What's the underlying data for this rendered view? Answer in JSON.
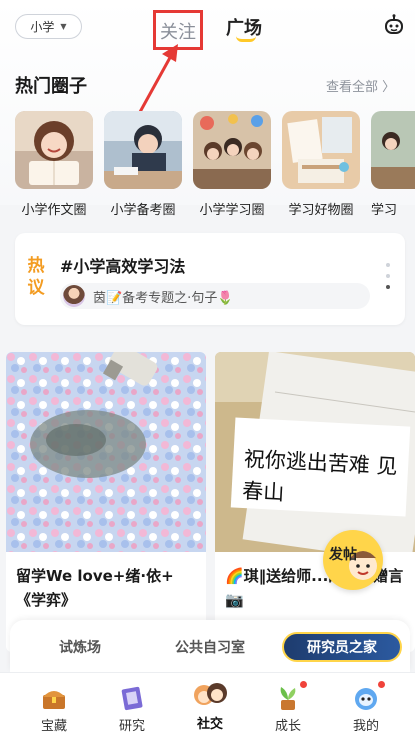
{
  "header": {
    "grade_label": "小学",
    "tabs": [
      {
        "label": "关注",
        "active": false
      },
      {
        "label": "广场",
        "active": true
      }
    ]
  },
  "hot_circles": {
    "title": "热门圈子",
    "see_all": "查看全部 〉",
    "items": [
      {
        "label": "小学作文圈",
        "icon": "girl-reading-icon"
      },
      {
        "label": "小学备考圈",
        "icon": "boy-studying-icon"
      },
      {
        "label": "小学学习圈",
        "icon": "students-group-icon"
      },
      {
        "label": "学习好物圈",
        "icon": "stationery-icon"
      },
      {
        "label": "学习",
        "icon": "classroom-icon"
      }
    ]
  },
  "hot_topic": {
    "badge": "热议",
    "title": "#小学高效学习法",
    "user_line": "茵📝备考专题之·句子🌷"
  },
  "feed": [
    {
      "caption": "留学We love+绪·依+《学弈》"
    },
    {
      "caption": "🌈琪‖送给师...的毕业赠言📷",
      "handwriting": "祝你逃出苦难 见春山"
    }
  ],
  "fab": {
    "label": "发帖"
  },
  "rooms": [
    "试炼场",
    "公共自习室",
    "研究员之家"
  ],
  "nav": [
    {
      "label": "宝藏",
      "icon": "treasure-chest-icon",
      "badge": false
    },
    {
      "label": "研究",
      "icon": "book-icon",
      "badge": false
    },
    {
      "label": "社交",
      "icon": "friends-icon",
      "badge": false,
      "active": true
    },
    {
      "label": "成长",
      "icon": "plant-icon",
      "badge": true
    },
    {
      "label": "我的",
      "icon": "robot-avatar-icon",
      "badge": true
    }
  ],
  "colors": {
    "accent_yellow": "#ffc928",
    "highlight_red": "#e53935",
    "hot_orange": "#f39c22"
  }
}
